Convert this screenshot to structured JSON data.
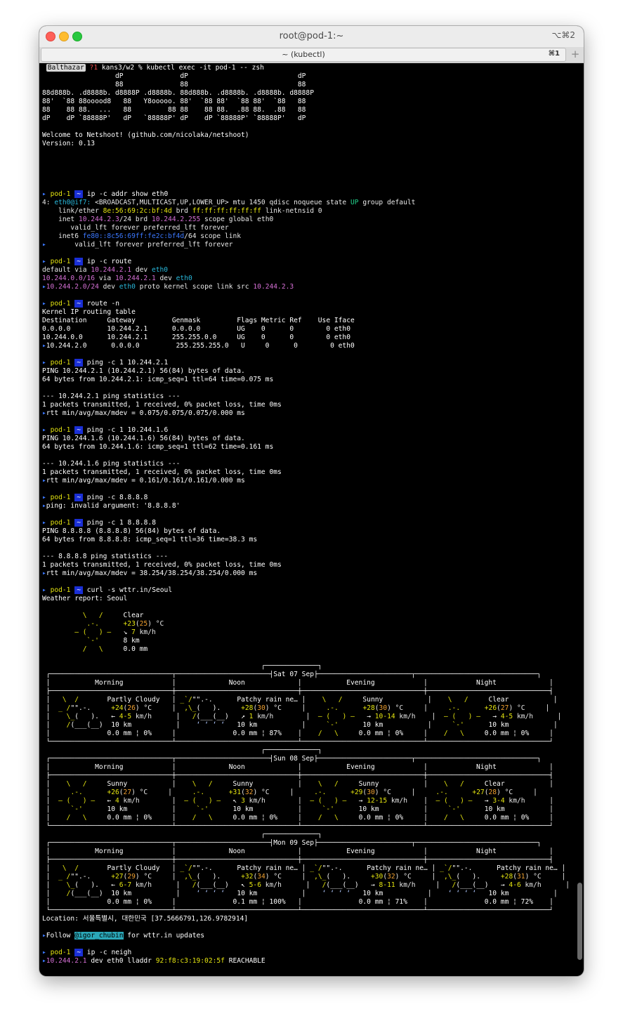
{
  "window": {
    "title": "root@pod-1:~",
    "shortcut": "⌥⌘2"
  },
  "tab": {
    "title": "~ (kubectl)",
    "shortcut": "⌘1",
    "new_tab": "+"
  },
  "prompt": {
    "host": "Balthazar",
    "status": "?1",
    "cwd": "kans3/w2 %",
    "pod": "pod-1",
    "arrow": "~"
  },
  "commands": {
    "exec": "kubectl exec -it pod-1 -- zsh",
    "addr": "ip -c addr show eth0",
    "route": "ip -c route",
    "route_n": "route -n",
    "ping1": "ping -c 1 10.244.2.1",
    "ping2": "ping -c 1 10.244.1.6",
    "ping3": "ping -c 8.8.8.8",
    "ping4": "ping -c 1 8.8.8.8",
    "curl": "curl -s wttr.in/Seoul",
    "neigh": "ip -c neigh"
  },
  "banner": [
    "                  dP              dP                           dP",
    "                  88              88                           88",
    "88d888b. .d8888b. d8888P .d8888b. 88d888b. .d8888b. .d8888b. d8888P",
    "88'  `88 88ooood8   88   Y8ooooo. 88'  `88 88'  `88 88'  `88   88",
    "88    88 88.  ...   88         88 88    88 88.  .88 88.  .88   88",
    "dP    dP `88888P'   dP   `88888P' dP    dP `88888P' `88888P'   dP"
  ],
  "welcome": "Welcome to Netshoot! (github.com/nicolaka/netshoot)",
  "version": "Version: 0.13",
  "addr": {
    "l1_pre": "4: ",
    "iface": "eth0@if7:",
    "l1_mid": " <BROADCAST,MULTICAST,UP,LOWER_UP> mtu 1450 qdisc noqueue state ",
    "state": "UP",
    "l1_post": " group default",
    "l2_pre": "    link/ether ",
    "mac": "8e:56:69:2c:bf:4d",
    "l2_mid": " brd ",
    "brd_mac": "ff:ff:ff:ff:ff:ff",
    "l2_post": " link-netnsid 0",
    "l3_pre": "    inet ",
    "inet": "10.244.2.3",
    "l3_mid1": "/24 brd ",
    "brd_ip": "10.244.2.255",
    "l3_mid2": " scope global ",
    "dev": "eth0",
    "l4": "       valid_lft forever preferred_lft forever",
    "l5_pre": "    inet6 ",
    "inet6": "fe80::8c56:69ff:fe2c:bf4d",
    "l5_post": "/64 scope link",
    "l6": "       valid_lft forever preferred_lft forever"
  },
  "route": {
    "r1_pre": "default via ",
    "r1_ip": "10.244.2.1",
    "r1_mid": " dev ",
    "r1_dev": "eth0",
    "r2_net": "10.244.0.0/16",
    "r2_mid1": " via ",
    "r2_ip": "10.244.2.1",
    "r2_mid2": " dev ",
    "r2_dev": "eth0",
    "r3_net": "10.244.2.0/24",
    "r3_mid1": " dev ",
    "r3_dev": "eth0",
    "r3_mid2": " proto kernel scope link src ",
    "r3_src": "10.244.2.3"
  },
  "route_table": [
    "Kernel IP routing table",
    "Destination     Gateway         Genmask         Flags Metric Ref    Use Iface",
    "0.0.0.0         10.244.2.1      0.0.0.0         UG    0      0        0 eth0",
    "10.244.0.0      10.244.2.1      255.255.0.0     UG    0      0        0 eth0",
    "10.244.2.0      0.0.0.0         255.255.255.0   U     0      0        0 eth0"
  ],
  "ping1": [
    "PING 10.244.2.1 (10.244.2.1) 56(84) bytes of data.",
    "64 bytes from 10.244.2.1: icmp_seq=1 ttl=64 time=0.075 ms",
    "",
    "--- 10.244.2.1 ping statistics ---",
    "1 packets transmitted, 1 received, 0% packet loss, time 0ms",
    "rtt min/avg/max/mdev = 0.075/0.075/0.075/0.000 ms"
  ],
  "ping2": [
    "PING 10.244.1.6 (10.244.1.6) 56(84) bytes of data.",
    "64 bytes from 10.244.1.6: icmp_seq=1 ttl=62 time=0.161 ms",
    "",
    "--- 10.244.1.6 ping statistics ---",
    "1 packets transmitted, 1 received, 0% packet loss, time 0ms",
    "rtt min/avg/max/mdev = 0.161/0.161/0.161/0.000 ms"
  ],
  "ping3_err": "ping: invalid argument: '8.8.8.8'",
  "ping4": [
    "PING 8.8.8.8 (8.8.8.8) 56(84) bytes of data.",
    "64 bytes from 8.8.8.8: icmp_seq=1 ttl=36 time=38.3 ms",
    "",
    "--- 8.8.8.8 ping statistics ---",
    "1 packets transmitted, 1 received, 0% packet loss, time 0ms",
    "rtt min/avg/max/mdev = 38.254/38.254/38.254/0.000 ms"
  ],
  "weather": {
    "report": "Weather report: Seoul",
    "current": {
      "condition": "Clear",
      "temp_a": "+23",
      "temp_b": "25",
      "unit": " °C",
      "wind_arrow": "↘",
      "wind": "7",
      "wind_unit": " km/h",
      "visibility": "8 km",
      "precip": "0.0 mm"
    },
    "headers": {
      "morning": "Morning",
      "noon": "Noon",
      "evening": "Evening",
      "night": "Night"
    },
    "days": [
      {
        "date": "Sat 07 Sep",
        "slots": [
          {
            "icon": "partly-cloudy",
            "cond": "Partly Cloudy",
            "ta": "+24",
            "tb": "26",
            "arrow": "←",
            "wind": "4-5",
            "vis": "10 km",
            "rain": "0.0 mm ¦ 0%"
          },
          {
            "icon": "rain",
            "cond": "Patchy rain ne…",
            "ta": "+28",
            "tb": "30",
            "arrow": "↗",
            "wind": "1",
            "vis": "10 km",
            "rain": "0.0 mm ¦ 87%"
          },
          {
            "icon": "sun",
            "cond": "Sunny",
            "ta": "+28",
            "tb": "30",
            "arrow": "→",
            "wind": "10-14",
            "vis": "10 km",
            "rain": "0.0 mm ¦ 0%"
          },
          {
            "icon": "sun",
            "cond": "Clear",
            "ta": "+26",
            "tb": "27",
            "arrow": "→",
            "wind": "4-5",
            "vis": "10 km",
            "rain": "0.0 mm ¦ 0%"
          }
        ]
      },
      {
        "date": "Sun 08 Sep",
        "slots": [
          {
            "icon": "sun",
            "cond": "Sunny",
            "ta": "+26",
            "tb": "27",
            "arrow": "←",
            "wind": "4",
            "vis": "10 km",
            "rain": "0.0 mm ¦ 0%"
          },
          {
            "icon": "sun",
            "cond": "Sunny",
            "ta": "+31",
            "tb": "32",
            "arrow": "↖",
            "wind": "3",
            "vis": "10 km",
            "rain": "0.0 mm ¦ 0%"
          },
          {
            "icon": "sun",
            "cond": "Sunny",
            "ta": "+29",
            "tb": "30",
            "arrow": "→",
            "wind": "12-15",
            "vis": "10 km",
            "rain": "0.0 mm ¦ 0%"
          },
          {
            "icon": "sun",
            "cond": "Clear",
            "ta": "+27",
            "tb": "28",
            "arrow": "→",
            "wind": "3-4",
            "vis": "10 km",
            "rain": "0.0 mm ¦ 0%"
          }
        ]
      },
      {
        "date": "Mon 09 Sep",
        "slots": [
          {
            "icon": "partly-cloudy",
            "cond": "Partly Cloudy",
            "ta": "+27",
            "tb": "29",
            "arrow": "←",
            "wind": "6-7",
            "vis": "10 km",
            "rain": "0.0 mm ¦ 0%"
          },
          {
            "icon": "rain",
            "cond": "Patchy rain ne…",
            "ta": "+32",
            "tb": "34",
            "arrow": "↖",
            "wind": "5-6",
            "vis": "10 km",
            "rain": "0.1 mm ¦ 100%"
          },
          {
            "icon": "rain",
            "cond": "Patchy rain ne…",
            "ta": "+30",
            "tb": "32",
            "arrow": "→",
            "wind": "8-11",
            "vis": "10 km",
            "rain": "0.0 mm ¦ 71%"
          },
          {
            "icon": "rain",
            "cond": "Patchy rain ne…",
            "ta": "+28",
            "tb": "31",
            "arrow": "→",
            "wind": "4-6",
            "vis": "10 km",
            "rain": "0.0 mm ¦ 72%"
          }
        ]
      }
    ],
    "location": "Location: 서울특별시, 대한민국 [37.5666791,126.9782914]",
    "follow_pre": "Follow ",
    "follow_handle": "@igor_chubin",
    "follow_post": " for wttr.in updates"
  },
  "neigh": {
    "ip": "10.244.2.1",
    "mid": " dev eth0 lladdr ",
    "mac": "92:f8:c3:19:02:5f",
    "state": " REACHABLE"
  },
  "colors": {
    "pod_name": "#e5e510",
    "prompt_arrow_bg": "#1a2fd6",
    "terminal_bg": "#000000",
    "link_bg": "#2aa7b8"
  }
}
